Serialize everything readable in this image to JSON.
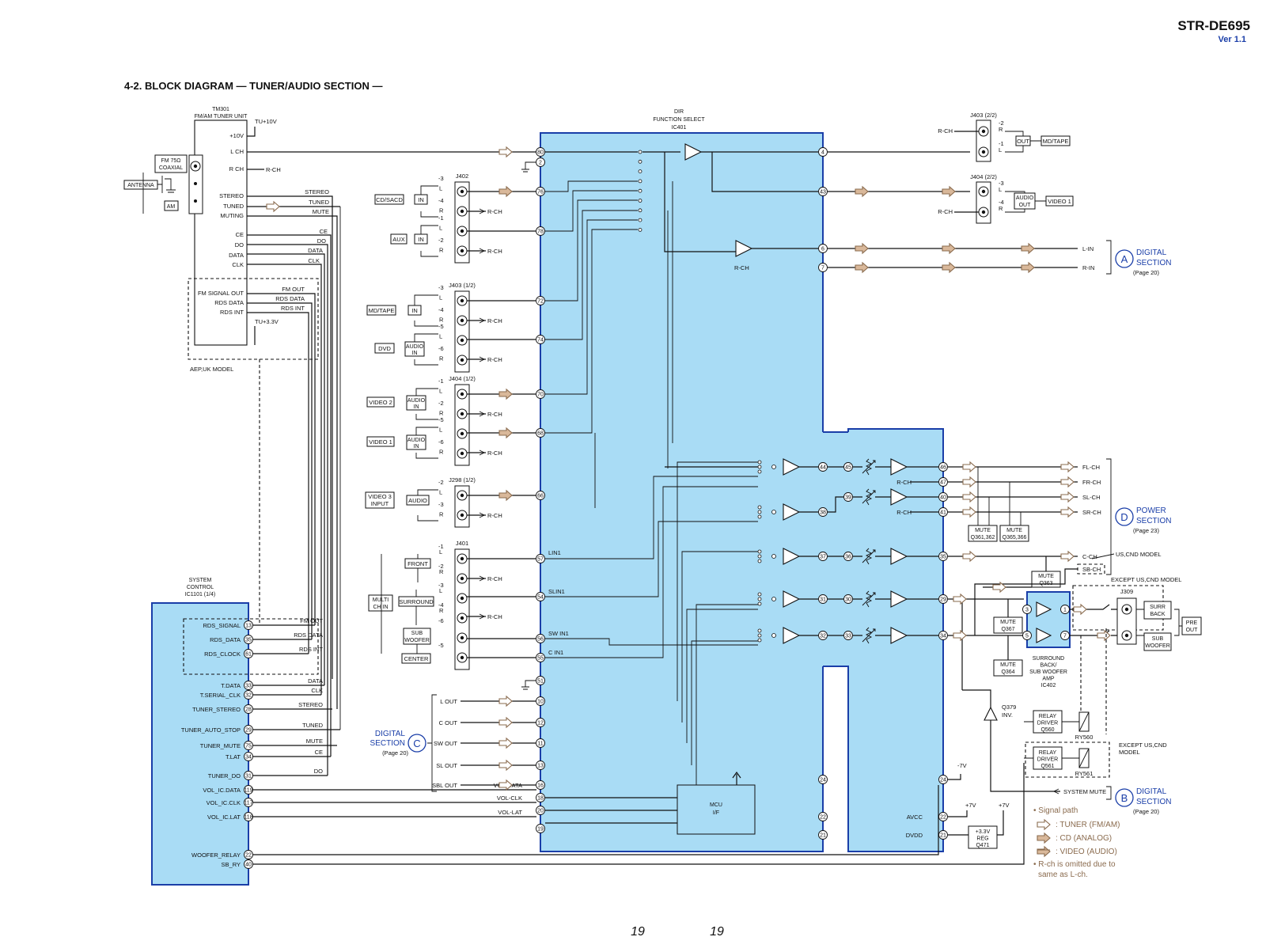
{
  "header": {
    "model": "STR-DE695",
    "version": "Ver 1.1",
    "title": "4-2. BLOCK DIAGRAM — TUNER/AUDIO SECTION —"
  },
  "tuner": {
    "ref": "TM301",
    "name": "FM/AM TUNER UNIT",
    "supply": "TU+10V",
    "supply33": "TU+3.3V",
    "antenna": "ANTENNA",
    "fm_line1": "FM 75Ω",
    "fm_line2": "COAXIAL",
    "am": "AM",
    "pins": [
      "+10V",
      "L CH",
      "R CH",
      "STEREO",
      "TUNED",
      "MUTING",
      "CE",
      "DO",
      "DATA",
      "CLK",
      "FM SIGNAL OUT",
      "RDS DATA",
      "RDS INT"
    ],
    "bus": [
      "STEREO",
      "TUNED",
      "MUTE",
      "CE",
      "DO",
      "DATA",
      "CLK",
      "FM OUT",
      "RDS DATA",
      "RDS INT"
    ],
    "model_note": "AEP,UK MODEL",
    "rch": "R-CH"
  },
  "ic401": {
    "line1": "DIR",
    "line2": "FUNCTION SELECT",
    "line3": "IC401",
    "left_pins": [
      "80",
      "2",
      "76",
      "78",
      "72",
      "74",
      "70",
      "68",
      "66",
      "57",
      "54",
      "56",
      "55",
      "51",
      "10",
      "12",
      "11",
      "13",
      "16",
      "18",
      "20",
      "19"
    ],
    "right_pins": [
      "4",
      "43",
      "6",
      "7",
      "44",
      "38",
      "37",
      "31",
      "32",
      "24",
      "22",
      "21"
    ],
    "pin_labels": {
      "lin1": "LIN1",
      "slin1": "SLIN1",
      "swin1": "SW IN1",
      "cin1": "C IN1",
      "avcc": "AVCC",
      "dvdd": "DVDD"
    },
    "mcu": [
      "MCU",
      "I/F"
    ]
  },
  "vol": {
    "pins": [
      "45",
      "39",
      "36",
      "30",
      "33"
    ],
    "out_pins": [
      "46",
      "47",
      "40",
      "41",
      "35",
      "29",
      "34"
    ]
  },
  "jacks": {
    "j402": "J402",
    "j403a": "J403 (1/2)",
    "j404a": "J404 (1/2)",
    "j298": "J298 (1/2)",
    "j401": "J401",
    "j403b": "J403 (2/2)",
    "j404b": "J404 (2/2)",
    "j309": "J309",
    "inputs": [
      {
        "name": "CD/SACD",
        "sub": "IN",
        "pins": [
          "-3",
          "L",
          "-4",
          "R"
        ]
      },
      {
        "name": "AUX",
        "sub": "IN",
        "pins": [
          "-1",
          "L",
          "-2",
          "R"
        ]
      },
      {
        "name": "MD/TAPE",
        "sub": "IN",
        "pins": [
          "-3",
          "L",
          "-4",
          "R"
        ]
      },
      {
        "name": "DVD",
        "sub": "AUDIO IN",
        "pins": [
          "-5",
          "L",
          "-6",
          "R"
        ]
      },
      {
        "name": "VIDEO 2",
        "sub": "AUDIO IN",
        "pins": [
          "-1",
          "L",
          "-2",
          "R"
        ]
      },
      {
        "name": "VIDEO 1",
        "sub": "AUDIO IN",
        "pins": [
          "-5",
          "L",
          "-6",
          "R"
        ]
      },
      {
        "name": "VIDEO 3 INPUT",
        "sub": "AUDIO",
        "pins": [
          "-2",
          "L",
          "-3",
          "R"
        ]
      }
    ],
    "multi": {
      "name": "MULTI CH IN",
      "front": "FRONT",
      "surround": "SURROUND",
      "sub": "SUB WOOFER",
      "center": "CENTER",
      "pins": [
        "-1",
        "L",
        "-2",
        "R",
        "-3",
        "L",
        "-4",
        "R",
        "-6",
        "-5"
      ]
    },
    "outs": {
      "md_tape": "MD/TAPE",
      "out": "OUT",
      "video1": "VIDEO 1",
      "audio_out": "AUDIO OUT",
      "pins_a": [
        "-2",
        "R",
        "-1",
        "L"
      ],
      "pins_b": [
        "-3",
        "L",
        "-4",
        "R"
      ]
    },
    "surr_back": "SURR BACK",
    "sub_woofer": "SUB WOOFER",
    "pre_out": "PRE OUT"
  },
  "digital_a": {
    "letter": "A",
    "line1": "DIGITAL",
    "line2": "SECTION",
    "page": "(Page 20)",
    "signals": [
      "L-IN",
      "R-IN"
    ]
  },
  "power_d": {
    "letter": "D",
    "line1": "POWER",
    "line2": "SECTION",
    "page": "(Page 23)",
    "signals": [
      "FL-CH",
      "FR-CH",
      "SL-CH",
      "SR-CH",
      "C-CH",
      "SB-CH"
    ],
    "note": "US,CND MODEL"
  },
  "digital_c": {
    "letter": "C",
    "line1": "DIGITAL",
    "line2": "SECTION",
    "page": "(Page 20)",
    "signals": [
      "L OUT",
      "C OUT",
      "SW OUT",
      "SL OUT",
      "SBL OUT"
    ]
  },
  "digital_b": {
    "letter": "B",
    "line1": "DIGITAL",
    "line2": "SECTION",
    "page": "(Page 20)",
    "signal": "SYSTEM MUTE"
  },
  "amp": {
    "mute1": [
      "MUTE",
      "Q361,362"
    ],
    "mute2": [
      "MUTE",
      "Q365,366"
    ],
    "mute3": [
      "MUTE",
      "Q363"
    ],
    "mute4": [
      "MUTE",
      "Q367"
    ],
    "mute5": [
      "MUTE",
      "Q364"
    ],
    "ic402": [
      "SURROUND",
      "BACK/",
      "SUB WOOFER",
      "AMP",
      "IC402"
    ],
    "ic402_pins": [
      "3",
      "1",
      "5",
      "7"
    ],
    "q379": [
      "Q379",
      "INV."
    ],
    "relay1": [
      "RELAY",
      "DRIVER",
      "Q560"
    ],
    "relay2": [
      "RELAY",
      "DRIVER",
      "Q561"
    ],
    "ry560": "RY560",
    "ry561": "RY561",
    "except1": "EXCEPT US,CND MODEL",
    "except2": [
      "EXCEPT US,CND",
      "MODEL"
    ],
    "reg": [
      "+3.3V",
      "REG",
      "Q471"
    ],
    "p7v": "+7V",
    "m7v": "-7V",
    "rch": "R-CH"
  },
  "sysctrl": {
    "line1": "SYSTEM",
    "line2": "CONTROL",
    "line3": "IC1101 (1/4)",
    "pins": [
      {
        "name": "RDS_SIGNAL",
        "num": "13",
        "sig": "FM OUT"
      },
      {
        "name": "RDS_DATA",
        "num": "35",
        "sig": "RDS DATA"
      },
      {
        "name": "RDS_CLOCK",
        "num": "61",
        "sig": "RDS INT"
      },
      {
        "name": "T.DATA",
        "num": "33",
        "sig": "DATA"
      },
      {
        "name": "T.SERIAL_CLK",
        "num": "32",
        "sig": "CLK"
      },
      {
        "name": "TUNER_STEREO",
        "num": "28",
        "sig": "STEREO"
      },
      {
        "name": "TUNER_AUTO_STOP",
        "num": "29",
        "sig": "TUNED"
      },
      {
        "name": "TUNER_MUTE",
        "num": "75",
        "sig": "MUTE"
      },
      {
        "name": "T.LAT",
        "num": "34",
        "sig": "CE"
      },
      {
        "name": "TUNER_DO",
        "num": "31",
        "sig": "DO"
      },
      {
        "name": "VOL_IC.DATA",
        "num": "119",
        "sig": "VOL-DATA"
      },
      {
        "name": "VOL_IC.CLK",
        "num": "117",
        "sig": "VOL-CLK"
      },
      {
        "name": "VOL_IC.LAT",
        "num": "118",
        "sig": "VOL-LAT"
      },
      {
        "name": "WOOFER_RELAY",
        "num": "22",
        "sig": ""
      },
      {
        "name": "SB_RY",
        "num": "40",
        "sig": ""
      }
    ]
  },
  "legend": {
    "title": "• Signal path",
    "items": [
      ": TUNER (FM/AM)",
      ": CD (ANALOG)",
      ": VIDEO (AUDIO)"
    ],
    "note1": "• R-ch is omitted due to",
    "note2": "same as L-ch."
  },
  "footer": {
    "left_page": "19",
    "right_page": "19"
  },
  "colors": {
    "ic_fill": "#a9dcf5",
    "ic_border": "#1a3ea8",
    "section_blue": "#1a3ea8",
    "legend_brown": "#8a6b4e"
  }
}
